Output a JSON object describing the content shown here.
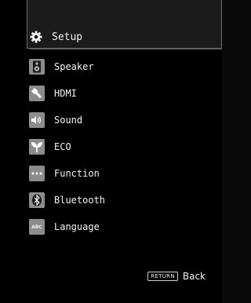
{
  "header": {
    "title": "Setup",
    "icon": "gear-icon"
  },
  "menu": {
    "items": [
      {
        "label": "Speaker",
        "icon": "speaker-icon"
      },
      {
        "label": "HDMI",
        "icon": "hdmi-plug-icon"
      },
      {
        "label": "Sound",
        "icon": "sound-icon"
      },
      {
        "label": "ECO",
        "icon": "leaf-icon"
      },
      {
        "label": "Function",
        "icon": "dots-icon"
      },
      {
        "label": "Bluetooth",
        "icon": "bluetooth-icon"
      },
      {
        "label": "Language",
        "icon": "language-abc-icon"
      }
    ]
  },
  "footer": {
    "return_key": "RETURN",
    "back_label": "Back"
  },
  "language_icon_text": "ABC"
}
